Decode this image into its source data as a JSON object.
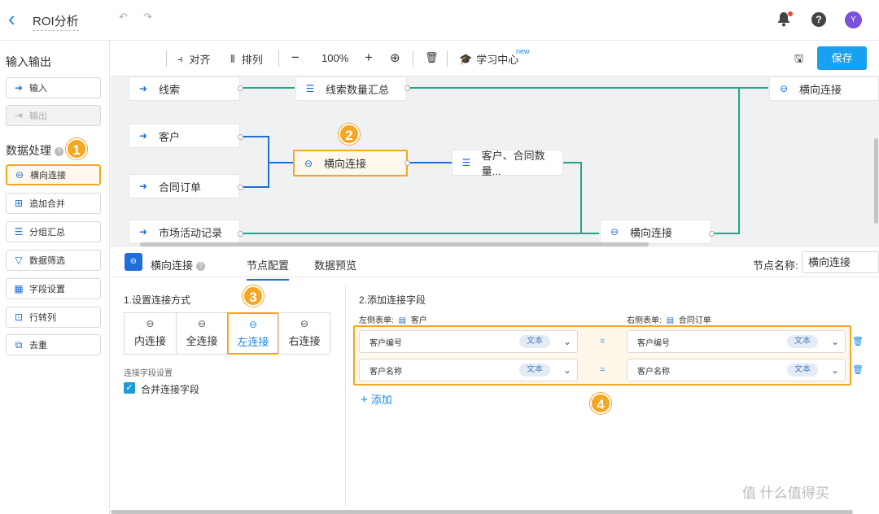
{
  "header": {
    "back_icon": "chevron-left-icon",
    "title": "ROI分析",
    "avatar_letter": "Y"
  },
  "sidebar": {
    "io_title": "输入输出",
    "io_items": [
      {
        "label": "输入",
        "icon": "input-arrow-icon"
      },
      {
        "label": "输出",
        "icon": "output-arrow-icon"
      }
    ],
    "proc_title": "数据处理",
    "proc_items": [
      {
        "label": "横向连接",
        "icon": "link-icon"
      },
      {
        "label": "追加合并",
        "icon": "append-icon"
      },
      {
        "label": "分组汇总",
        "icon": "list-icon"
      },
      {
        "label": "数据筛选",
        "icon": "filter-icon"
      },
      {
        "label": "字段设置",
        "icon": "table-icon"
      },
      {
        "label": "行转列",
        "icon": "pivot-icon"
      },
      {
        "label": "去重",
        "icon": "dedupe-icon"
      }
    ]
  },
  "badges": {
    "b1": "1",
    "b2": "2",
    "b3": "3",
    "b4": "4"
  },
  "toolbar": {
    "align": "对齐",
    "arrange": "排列",
    "zoom": "100%",
    "learn": "学习中心",
    "new_tag": "new",
    "save": "保存"
  },
  "canvas": {
    "nodes": {
      "xiansuo": "线索",
      "xiansuo_sum": "线索数量汇总",
      "join_top": "横向连接",
      "kehu": "客户",
      "join_sel": "横向连接",
      "kehu_sum": "客户、合同数量...",
      "hetong": "合同订单",
      "shichang": "市场活动记录",
      "join_bottom": "横向连接"
    }
  },
  "config": {
    "node_title": "横向连接",
    "tabs": [
      "节点配置",
      "数据预览"
    ],
    "node_name_label": "节点名称:",
    "node_name": "横向连接",
    "section1": "1.设置连接方式",
    "join_types": [
      "内连接",
      "全连接",
      "左连接",
      "右连接"
    ],
    "selected_join": "左连接",
    "join_field_setting": "连接字段设置",
    "merge_fields": "合并连接字段",
    "section2": "2.添加连接字段",
    "left_table_label": "左侧表单:",
    "left_table": "客户",
    "right_table_label": "右侧表单:",
    "right_table": "合同订单",
    "rows": [
      {
        "left": "客户编号",
        "left_type": "文本",
        "eq": "=",
        "right": "客户编号",
        "right_type": "文本"
      },
      {
        "left": "客户名称",
        "left_type": "文本",
        "eq": "=",
        "right": "客户名称",
        "right_type": "文本"
      }
    ],
    "add": "添加"
  },
  "watermark": "值 什么值得买",
  "colors": {
    "accent": "#1e88e5",
    "highlight": "#f5a623",
    "save": "#1aa0f0",
    "line_green": "#1aa88a",
    "line_blue": "#1e6fd9"
  }
}
